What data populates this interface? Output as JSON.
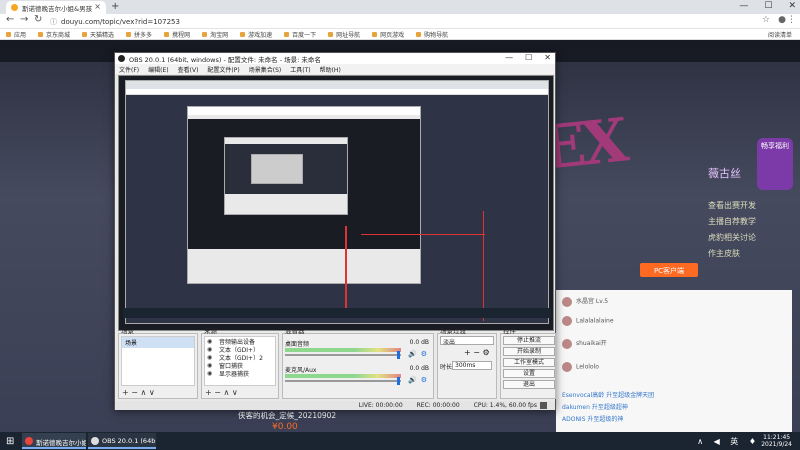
{
  "browser": {
    "tab_title": "斯诺德晚吉尔小姐&男孩",
    "url": "douyu.com/topic/vex?rid=107253",
    "bookmarks": [
      "应用",
      "京东商城",
      "天猫精选",
      "拼多多",
      "携程网",
      "淘宝网",
      "游戏加速",
      "百度一下",
      "网址导航",
      "网页游戏",
      "购物导航"
    ],
    "read_mode": "阅读清单",
    "new_tab": "+",
    "window_controls": [
      "—",
      "☐",
      "✕"
    ]
  },
  "page": {
    "deco_text": "EX",
    "deco_name": "薇古丝",
    "side_links": [
      "查看出赛开发",
      "主播自荐教学",
      "虎豹相关讨论",
      "作主皮肤"
    ],
    "promo": "畅享福利",
    "pc_button": "PC客户端",
    "chat_rows": [
      "水晶宫 Lv.5",
      "Lalalalalaine",
      "shuaikai开",
      "Lelololo",
      "Esenvocal高龄 升至超级金牌天团",
      "dakumen 升至超级超神",
      "ADONIS 升至超级的神"
    ],
    "stream_title": "侠客的机会_定候_20210902",
    "price": "¥0.00"
  },
  "obs": {
    "title": "OBS 20.0.1 (64bit, windows) - 配置文件: 未命名 - 场景: 未命名",
    "menu": [
      "文件(F)",
      "编辑(E)",
      "查看(V)",
      "配置文件(P)",
      "场景集合(S)",
      "工具(T)",
      "帮助(H)"
    ],
    "docks": {
      "scenes_title": "场景",
      "sources_title": "来源",
      "mixer_title": "混音器",
      "transitions_title": "场景过渡",
      "controls_title": "控件"
    },
    "scenes": [
      "场景"
    ],
    "sources": [
      "音频输出设备",
      "文本（GDI+）",
      "文本（GDI+）2",
      "窗口捕获",
      "显示器捕获"
    ],
    "mixer": [
      {
        "label": "桌面音频",
        "db": "0.0 dB"
      },
      {
        "label": "麦克风/Aux",
        "db": "0.0 dB"
      }
    ],
    "transition": {
      "type": "淡出",
      "duration_label": "时长",
      "duration": "300ms"
    },
    "controls": [
      "停止推流",
      "开始录制",
      "工作室模式",
      "设置",
      "退出"
    ],
    "status": [
      "LIVE: 00:00:00",
      "REC: 00:00:00",
      "CPU: 1.4%, 60.00 fps"
    ],
    "tool_glyphs": "+ − ∧ ∨"
  },
  "taskbar": {
    "tasks": [
      "斯诺德晚吉尔小姐...",
      "OBS 20.0.1 (64bit..."
    ],
    "tray": "∧ ◀ 英 ♦",
    "time": "11:21:45",
    "date": "2021/9/24"
  }
}
